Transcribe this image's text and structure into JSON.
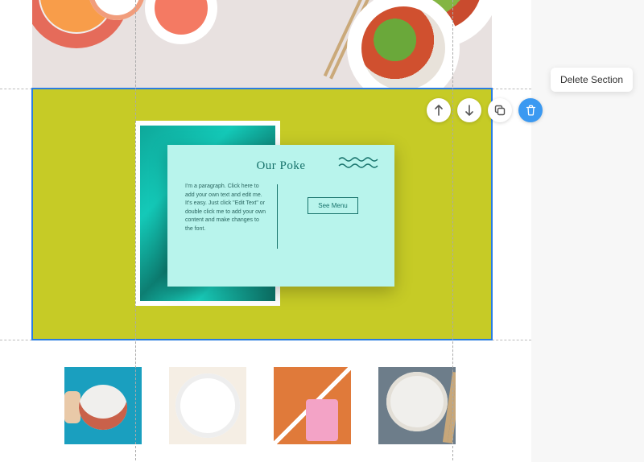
{
  "tooltip": {
    "delete_section": "Delete Section"
  },
  "card": {
    "title": "Our Poke",
    "paragraph": "I'm a paragraph. Click here to add your own text and edit me. It's easy. Just click \"Edit Text\" or double click me to add your own content and make changes to the font.",
    "button": "See Menu"
  },
  "actions": {
    "move_up": "Move Up",
    "move_down": "Move Down",
    "duplicate": "Duplicate",
    "delete": "Delete"
  },
  "colors": {
    "selection": "#2a7de1",
    "section_bg": "#c6cb26",
    "card_bg": "#b8f4ec",
    "accent": "#17726b",
    "action_primary": "#3b99f1"
  }
}
